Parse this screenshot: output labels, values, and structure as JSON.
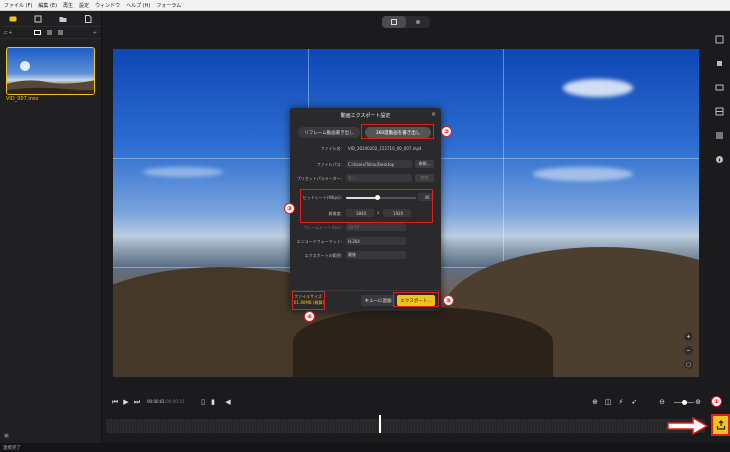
{
  "menu": [
    "ファイル (F)",
    "編集 (E)",
    "再生",
    "設定",
    "ウィンドウ",
    "ヘルプ (H)",
    "フォーラム"
  ],
  "left_panel": {
    "tab_icons": [
      "media-icon",
      "project-icon",
      "folder-icon",
      "file-icon"
    ],
    "tool_label": "⊏+",
    "tool_plus": "+",
    "thumbnail_name": "VID_007.insv",
    "bottom_label": "▣"
  },
  "dialog": {
    "title": "動画エクスポート設定",
    "close": "×",
    "mode_reframe": "リフレーム動画書き出し",
    "mode_360": "360度動画を書き出し",
    "filename_label": "ファイル名:",
    "filename_value": "VID_20240202_152710_00_007.mp4",
    "filepath_label": "ファイルパス:",
    "filepath_value": "C:/Users/Tatsu/Desktop",
    "browse_button": "参照...",
    "preset_label": "プリセットパラメーター:",
    "preset_value": "なし",
    "preset_delete": "削除",
    "bitrate_label": "ビットレート(Mbps):",
    "bitrate_value": "46",
    "resolution_label": "解像度:",
    "resolution_w": "3840",
    "resolution_x": "x",
    "resolution_h": "1920",
    "framerate_label": "フレームレート(fps):",
    "framerate_value": "29.97",
    "encoder_label": "エンコードフォーマット:",
    "encoder_value": "H.264",
    "export_area_label": "エクスポートの範囲:",
    "export_area_value": "最後",
    "filesize_label": "ファイルサイズ",
    "filesize_value": "61.80MB (概算)",
    "queue_button": "キューに追加",
    "export_button": "エクスポート..."
  },
  "bitrate_fraction": 0.45,
  "badges": [
    "②",
    "③",
    "④",
    "⑤",
    "①"
  ],
  "controls": {
    "time_current": "00:00:01",
    "time_total": "/00:00:15"
  },
  "status": "連携完了",
  "colors": {
    "accent": "#f0c419",
    "annotation": "#e01e1e"
  }
}
